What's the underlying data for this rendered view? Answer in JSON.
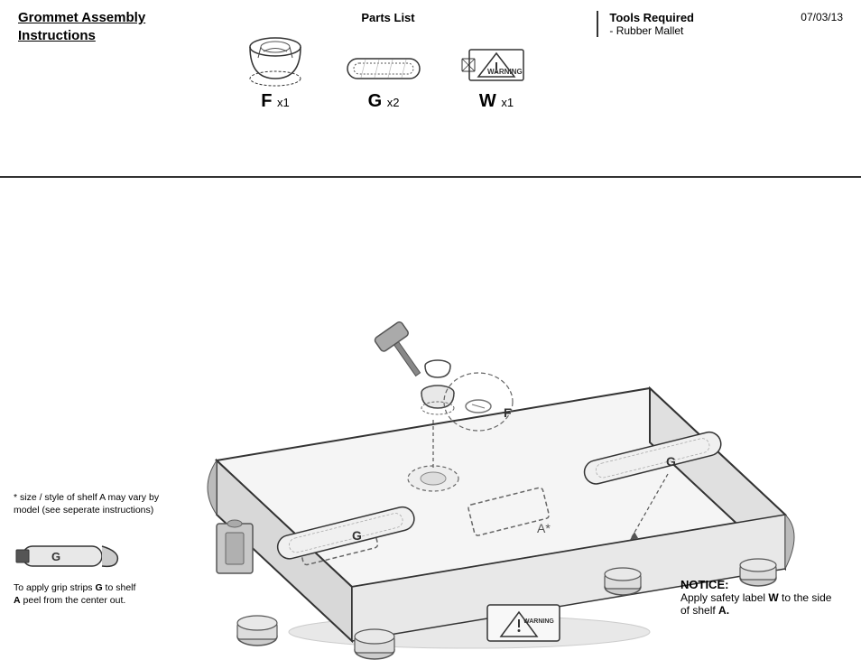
{
  "header": {
    "title": "Grommet Assembly Instructions",
    "date": "07/03/13"
  },
  "parts_list": {
    "label": "Parts List",
    "items": [
      {
        "id": "F",
        "qty": "x1",
        "description": "grommet"
      },
      {
        "id": "G",
        "qty": "x2",
        "description": "grip strip"
      },
      {
        "id": "W",
        "qty": "x1",
        "description": "warning label"
      }
    ]
  },
  "tools": {
    "title": "Tools Required",
    "items": [
      "Rubber Mallet"
    ]
  },
  "notes": {
    "asterisk": "* size / style of shelf A may vary by model (see seperate instructions)",
    "g_strip": "To apply grip strips G to shelf A peel from the center out."
  },
  "notice": {
    "title": "NOTICE:",
    "text": "Apply safety label W to the side of shelf A."
  },
  "labels": {
    "F": "F",
    "G": "G",
    "A_star": "A*",
    "W_label": "W"
  }
}
